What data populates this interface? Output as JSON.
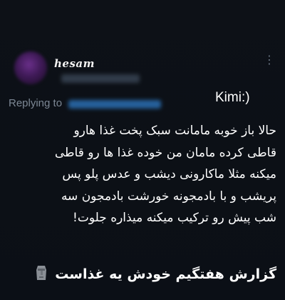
{
  "post": {
    "username": "hesam",
    "replying_label": "Replying to",
    "overlay_note": "Kimi:)",
    "body_lines": [
      "حالا باز خوبه مامانت سبک پخت غذا هارو",
      "قاطی کرده مامان من خوده غذا ها رو قاطی",
      "میکنه مثلا ماکارونی دیشب و عدس پلو پس",
      "پریشب و با بادمجونه خورشت بادمجون سه",
      "شب پیش رو ترکیب میکنه میذاره جلوت!"
    ],
    "caption": "گزارش هفتگیم خودش یه غذاست",
    "caption_icon": "moai-icon"
  }
}
